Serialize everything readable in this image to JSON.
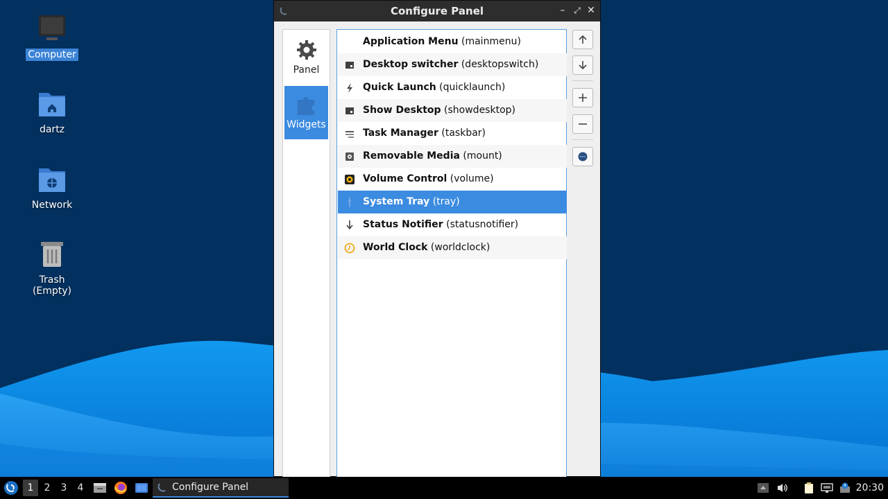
{
  "desktop": {
    "icons": [
      {
        "label": "Computer",
        "icon": "computer-icon"
      },
      {
        "label": "dartz",
        "icon": "home-folder-icon"
      },
      {
        "label": "Network",
        "icon": "network-folder-icon"
      },
      {
        "label": "Trash (Empty)",
        "icon": "trash-icon"
      }
    ]
  },
  "window": {
    "title": "Configure Panel",
    "controls": {
      "minimize": "–",
      "maximize": "⤢",
      "close": "✕"
    },
    "tabs": [
      {
        "label": "Panel",
        "icon": "gear-icon"
      },
      {
        "label": "Widgets",
        "icon": "puzzle-icon",
        "active": true
      }
    ],
    "plugins": [
      {
        "name": "Application Menu",
        "id": "(mainmenu)",
        "icon": "app-menu-icon"
      },
      {
        "name": "Desktop switcher",
        "id": "(desktopswitch)",
        "icon": "desktop-switcher-icon"
      },
      {
        "name": "Quick Launch",
        "id": "(quicklaunch)",
        "icon": "lightning-icon"
      },
      {
        "name": "Show Desktop",
        "id": "(showdesktop)",
        "icon": "show-desktop-icon"
      },
      {
        "name": "Task Manager",
        "id": "(taskbar)",
        "icon": "task-manager-icon"
      },
      {
        "name": "Removable Media",
        "id": "(mount)",
        "icon": "drive-icon"
      },
      {
        "name": "Volume Control",
        "id": "(volume)",
        "icon": "speaker-icon"
      },
      {
        "name": "System Tray",
        "id": "(tray)",
        "icon": "tray-icon",
        "selected": true
      },
      {
        "name": "Status Notifier",
        "id": "(statusnotifier)",
        "icon": "notifier-icon"
      },
      {
        "name": "World Clock",
        "id": "(worldclock)",
        "icon": "clock-icon"
      }
    ],
    "buttons": [
      "move-up-icon",
      "move-down-icon",
      "add-icon",
      "remove-icon",
      "configure-icon"
    ]
  },
  "taskbar": {
    "workspaces": [
      "1",
      "2",
      "3",
      "4"
    ],
    "active_workspace": "1",
    "task": "Configure Panel",
    "clock": "20:30"
  },
  "colors": {
    "accent": "#3b8be0",
    "desktop_bg": "#02305f",
    "wave": "#0a86e6",
    "taskbar": "#000000"
  }
}
